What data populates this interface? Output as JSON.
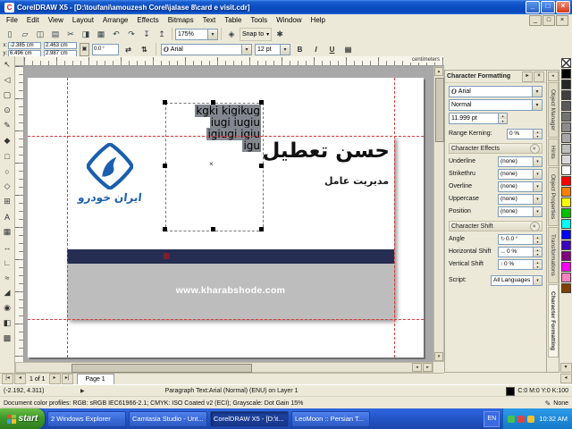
{
  "window": {
    "title": "CorelDRAW X5 - [D:\\toufani\\amouzesh Corel\\jalase 8\\card e visit.cdr]",
    "buttons": {
      "minimize": "_",
      "maximize": "□",
      "close": "×"
    }
  },
  "menu": {
    "items": [
      "File",
      "Edit",
      "View",
      "Layout",
      "Arrange",
      "Effects",
      "Bitmaps",
      "Text",
      "Table",
      "Tools",
      "Window",
      "Help"
    ]
  },
  "toolbar": {
    "icons": [
      {
        "glyph": "▯",
        "name": "new-icon"
      },
      {
        "glyph": "▱",
        "name": "open-icon"
      },
      {
        "glyph": "◫",
        "name": "save-icon"
      },
      {
        "glyph": "▤",
        "name": "print-icon"
      },
      {
        "glyph": "✂",
        "name": "cut-icon"
      },
      {
        "glyph": "◨",
        "name": "copy-icon"
      },
      {
        "glyph": "▦",
        "name": "paste-icon"
      },
      {
        "glyph": "↶",
        "name": "undo-icon"
      },
      {
        "glyph": "↷",
        "name": "redo-icon"
      },
      {
        "glyph": "↧",
        "name": "import-icon"
      },
      {
        "glyph": "↥",
        "name": "export-icon"
      }
    ],
    "zoom": "175%",
    "snap_label": "Snap to",
    "launcher_glyph": "◈",
    "options_glyph": "✱"
  },
  "property_bar": {
    "x_label": "x:",
    "x_value": "-2.385 cm",
    "y_label": "y:",
    "y_value": "6.496 cm",
    "width_value": "2.463 cm",
    "height_value": "2.987 cm",
    "lock_glyph": "▣",
    "angle_value": "0.0",
    "angle_unit": "°",
    "mirror_h_glyph": "⇄",
    "mirror_v_glyph": "⇅",
    "font": "Arial",
    "size": "12 pt",
    "bold": "B",
    "italic": "I",
    "underline": "U",
    "align_glyph": "▤"
  },
  "ruler": {
    "units": "centimeters"
  },
  "toolbox": {
    "tools": [
      {
        "glyph": "↖",
        "name": "pick-tool"
      },
      {
        "glyph": "◁",
        "name": "shape-tool"
      },
      {
        "glyph": "▢",
        "name": "crop-tool"
      },
      {
        "glyph": "⊙",
        "name": "zoom-tool"
      },
      {
        "glyph": "✎",
        "name": "freehand-tool"
      },
      {
        "glyph": "◆",
        "name": "smart-fill-tool"
      },
      {
        "glyph": "□",
        "name": "rectangle-tool"
      },
      {
        "glyph": "○",
        "name": "ellipse-tool"
      },
      {
        "glyph": "◇",
        "name": "polygon-tool"
      },
      {
        "glyph": "⊞",
        "name": "basic-shapes-tool"
      },
      {
        "glyph": "A",
        "name": "text-tool"
      },
      {
        "glyph": "▦",
        "name": "table-tool"
      },
      {
        "glyph": "↔",
        "name": "dimension-tool"
      },
      {
        "glyph": "∟",
        "name": "connector-tool"
      },
      {
        "glyph": "≈",
        "name": "blend-tool"
      },
      {
        "glyph": "◢",
        "name": "eyedropper-tool"
      },
      {
        "glyph": "◉",
        "name": "outline-pen-tool"
      },
      {
        "glyph": "◧",
        "name": "fill-tool"
      },
      {
        "glyph": "▩",
        "name": "interactive-fill-tool"
      }
    ]
  },
  "canvas": {
    "selected_text": {
      "lines": [
        "kgki kigikug",
        "iugi iugiu",
        "igiugi igiu",
        "igu"
      ]
    },
    "card": {
      "name": "حسن تعطیل",
      "title": "مدیریت عامل",
      "logo_text": "ايران خودرو",
      "website": "www.kharabshode.com"
    }
  },
  "docker": {
    "title": "Character Formatting",
    "font_icon": "O",
    "font": "Arial",
    "style": "Normal",
    "size": "11.999 pt",
    "kerning_label": "Range Kerning:",
    "kerning_value": "0 %",
    "effects": {
      "title": "Character Effects",
      "rows": [
        {
          "label": "Underline",
          "value": "(none)"
        },
        {
          "label": "Strikethru",
          "value": "(none)"
        },
        {
          "label": "Overline",
          "value": "(none)"
        },
        {
          "label": "Uppercase",
          "value": "(none)"
        },
        {
          "label": "Position",
          "value": "(none)"
        }
      ]
    },
    "shift": {
      "title": "Character Shift",
      "rows": [
        {
          "label": "Angle",
          "icon": "↻",
          "value": "0.0 °"
        },
        {
          "label": "Horizontal Shift",
          "icon": "↔",
          "value": "0 %"
        },
        {
          "label": "Vertical Shift",
          "icon": "↕",
          "value": "0 %"
        }
      ]
    },
    "script_label": "Script:",
    "script_value": "All Languages"
  },
  "docker_tabs": [
    "Object Manager",
    "Hints",
    "Object Properties",
    "Transformations",
    "Character Formatting"
  ],
  "palette": {
    "colors": [
      "none",
      "#000000",
      "#262626",
      "#404040",
      "#595959",
      "#737373",
      "#8c8c8c",
      "#a6a6a6",
      "#bfbfbf",
      "#d9d9d9",
      "#ffffff",
      "#ff0000",
      "#ff8000",
      "#ffff00",
      "#00c000",
      "#00ffff",
      "#0000ff",
      "#4000c0",
      "#800080",
      "#ff00ff",
      "#ff80c0",
      "#804000"
    ]
  },
  "page_nav": {
    "position": "1 of 1",
    "tab": "Page 1"
  },
  "status": {
    "coords": "(-2.192, 4.311)",
    "object_info": "Paragraph Text:Arial (Normal) (ENU) on Layer 1",
    "fill_value": "C:0 M:0 Y:0 K:100",
    "outline_value": "None",
    "profiles": "Document color profiles: RGB: sRGB IEC61966-2.1; CMYK: ISO Coated v2 (ECI); Grayscale: Dot Gain 15%"
  },
  "taskbar": {
    "start": "start",
    "buttons": [
      "2 Windows Explorer",
      "Camtasia Studio - Unt...",
      "CorelDRAW X5 - [D:\\t...",
      "LeoMoon :: Persian T..."
    ],
    "language": "EN",
    "time": "10:32 AM"
  }
}
